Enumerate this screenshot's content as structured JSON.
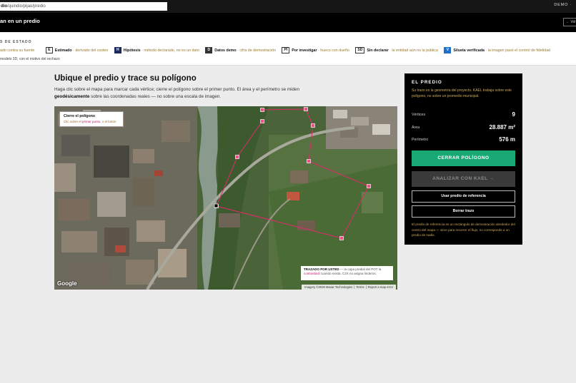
{
  "browser": {
    "address_prefix": "dio",
    "address_path": "/quindio/pijao/predio",
    "demo_label": "DEMO ·"
  },
  "header": {
    "title": "an en un predio",
    "back_label": "← Vol"
  },
  "legend": {
    "heading": "S DE ESTADO",
    "items": [
      {
        "chip": "",
        "label": "",
        "desc": "ado contra su fuente"
      },
      {
        "chip": "E",
        "label": "Estimado",
        "desc": "· derivado del costeo"
      },
      {
        "chip": "H",
        "label": "Hipótesis",
        "desc": "· método declarado, no es un dato"
      },
      {
        "chip": "D",
        "label": "Datos demo",
        "desc": "· cifra de demostración"
      },
      {
        "chip": "PI",
        "label": "Por investigar",
        "desc": "· hueco con dueño"
      },
      {
        "chip": "SD",
        "label": "Sin declarar",
        "desc": "· la entidad aún no la publica"
      },
      {
        "chip": "V",
        "label": "Silueta verificada",
        "desc": "· la imagen pasó el control de fidelidad"
      }
    ],
    "note": "modelo 3D, con el motivo del rechazo"
  },
  "main": {
    "title": "Ubique el predio y trace su polígono",
    "intro_before": "Haga clic sobre el mapa para marcar cada vértice; cierre el polígono sobre el primer punto. El área y el perímetro se miden ",
    "intro_bold": "geodésicamente",
    "intro_after": " sobre las coordenadas reales — no sobre una escala de imagen."
  },
  "map": {
    "tooltip_title": "Cierre el polígono",
    "tooltip_pre": "Clic sobre el ",
    "tooltip_hl": "primer punto",
    "tooltip_post": ", o el botón",
    "note_bold": "TRAZADO POR USTED",
    "note_pre": " — la capa predial del POT la ",
    "note_hl": "contrastará",
    "note_post": " cuando exista. C2X no asigna linderos.",
    "google": "Google",
    "imagery": "Imagery ©2026 Maxar Technologies",
    "terms": "Terms",
    "report": "Report a map error",
    "vertices": [
      [
        291,
        5
      ],
      [
        358,
        22
      ],
      [
        440,
        112
      ],
      [
        402,
        185
      ],
      [
        256,
        71
      ],
      [
        227,
        140
      ],
      [
        291,
        21
      ],
      [
        330,
        33
      ],
      [
        355,
        77
      ]
    ],
    "colors": {
      "polygon": "#e2296c",
      "vertex": "#f0508a"
    }
  },
  "panel": {
    "title": "EL PREDIO",
    "subtitle": "Su trazo es la geometría del proyecto. KAEL trabaja sobre este polígono, no sobre un promedio municipal.",
    "stats": [
      {
        "label": "Vértices",
        "value": "9"
      },
      {
        "label": "Área",
        "value": "28.887 m²"
      },
      {
        "label": "Perímetro",
        "value": "576 m"
      }
    ],
    "primary_btn": "CERRAR POLÍGONO",
    "analyze_btn": "ANALIZAR CON KAEL →",
    "reference_btn": "Usar predio de referencia",
    "clear_btn": "Borrar trazo",
    "footnote": "El predio de referencia es un rectángulo de demostración alrededor del centro del mapa — sirve para recorrer el flujo, no corresponde a un predio de nadie.",
    "colors": {
      "primary": "#19a974",
      "accent_text": "#c9a85e"
    }
  }
}
